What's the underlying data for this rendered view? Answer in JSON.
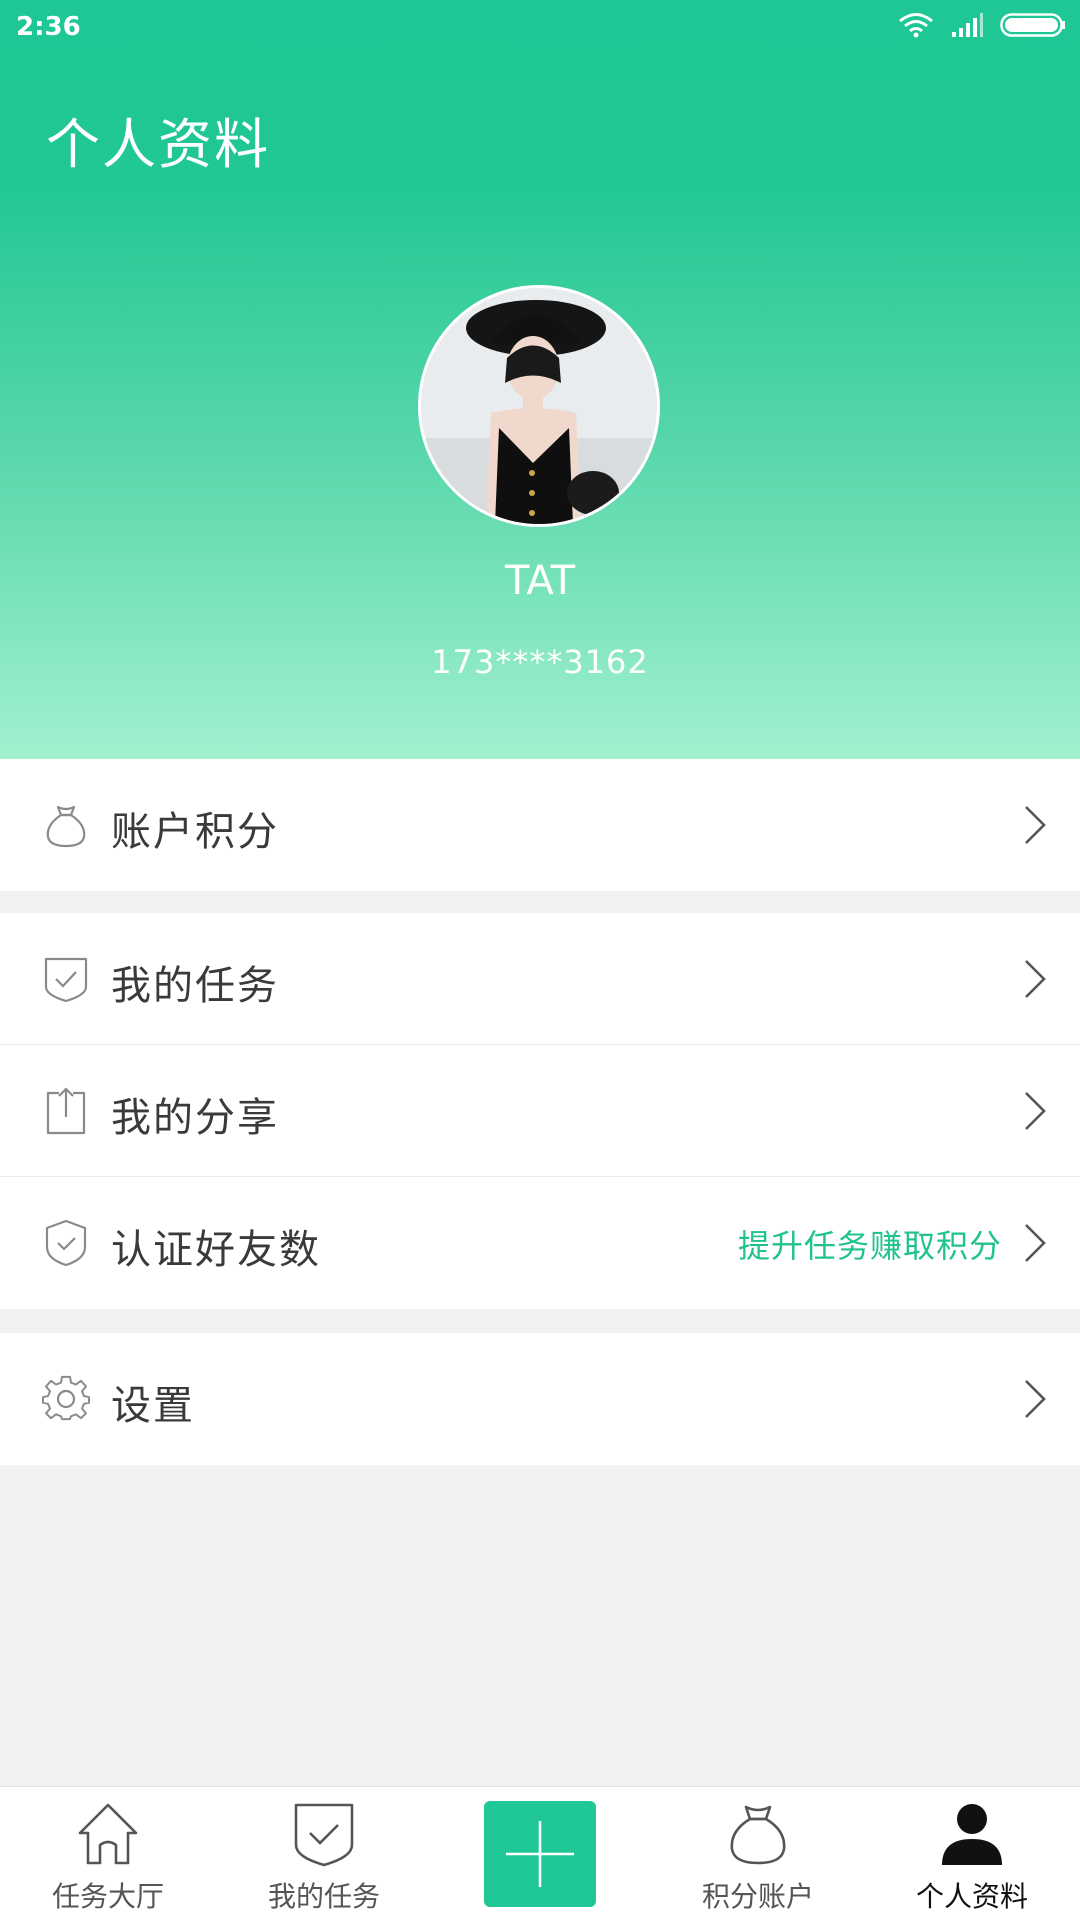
{
  "status_bar": {
    "time": "2:36"
  },
  "header": {
    "title": "个人资料"
  },
  "profile": {
    "name": "TAT",
    "phone": "173****3162"
  },
  "menu": {
    "account_points": {
      "label": "账户积分"
    },
    "my_tasks": {
      "label": "我的任务"
    },
    "my_share": {
      "label": "我的分享"
    },
    "verified_friends": {
      "label": "认证好友数",
      "hint": "提升任务赚取积分"
    },
    "settings": {
      "label": "设置"
    }
  },
  "tabbar": {
    "items": [
      {
        "label": "任务大厅",
        "icon": "home-icon"
      },
      {
        "label": "我的任务",
        "icon": "shield-check-icon"
      },
      {
        "label": "",
        "icon": "plus-icon"
      },
      {
        "label": "积分账户",
        "icon": "money-bag-icon"
      },
      {
        "label": "个人资料",
        "icon": "person-icon",
        "active": true
      }
    ]
  },
  "colors": {
    "accent": "#1ec795",
    "hint": "#20c38f",
    "background": "#f2f2f2"
  }
}
